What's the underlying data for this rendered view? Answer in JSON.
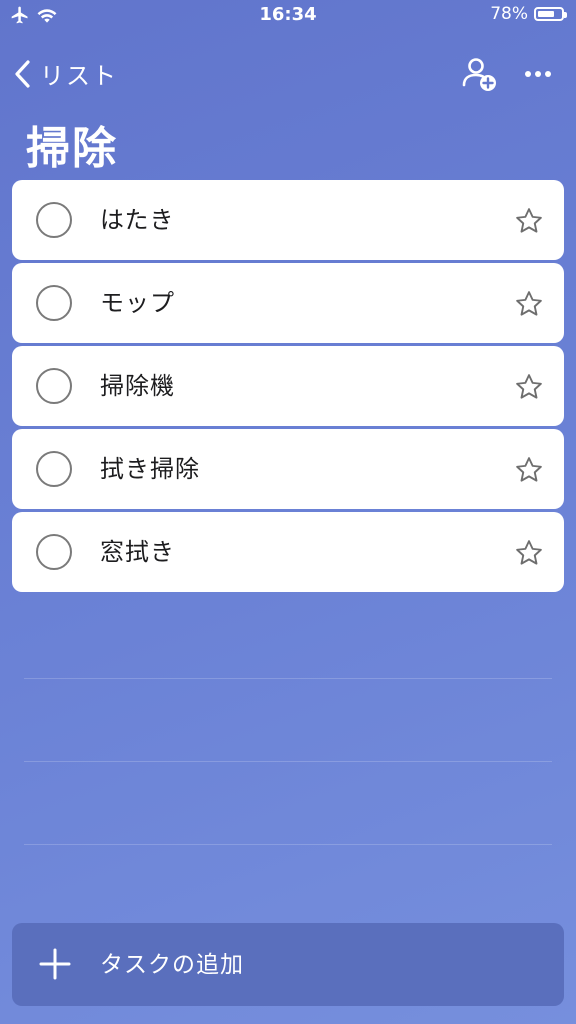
{
  "status_bar": {
    "time": "16:34",
    "battery_percent": "78%",
    "battery_level": 0.78,
    "icons": [
      "airplane-icon",
      "wifi-icon",
      "battery-icon"
    ]
  },
  "nav": {
    "back_label": "リスト",
    "icons": [
      "chevron-left-icon",
      "add-person-icon",
      "more-icon"
    ]
  },
  "list": {
    "title": "掃除"
  },
  "tasks": [
    {
      "label": "はたき",
      "completed": false,
      "important": false
    },
    {
      "label": "モップ",
      "completed": false,
      "important": false
    },
    {
      "label": "掃除機",
      "completed": false,
      "important": false
    },
    {
      "label": "拭き掃除",
      "completed": false,
      "important": false
    },
    {
      "label": "窓拭き",
      "completed": false,
      "important": false
    }
  ],
  "add_task": {
    "label": "タスクの追加",
    "icon": "plus-icon"
  },
  "colors": {
    "background_top": "#6175cc",
    "background_bottom": "#768fdd",
    "add_bar": "#5a6fbd",
    "card": "#ffffff",
    "text_dark": "#1d1d1f"
  }
}
